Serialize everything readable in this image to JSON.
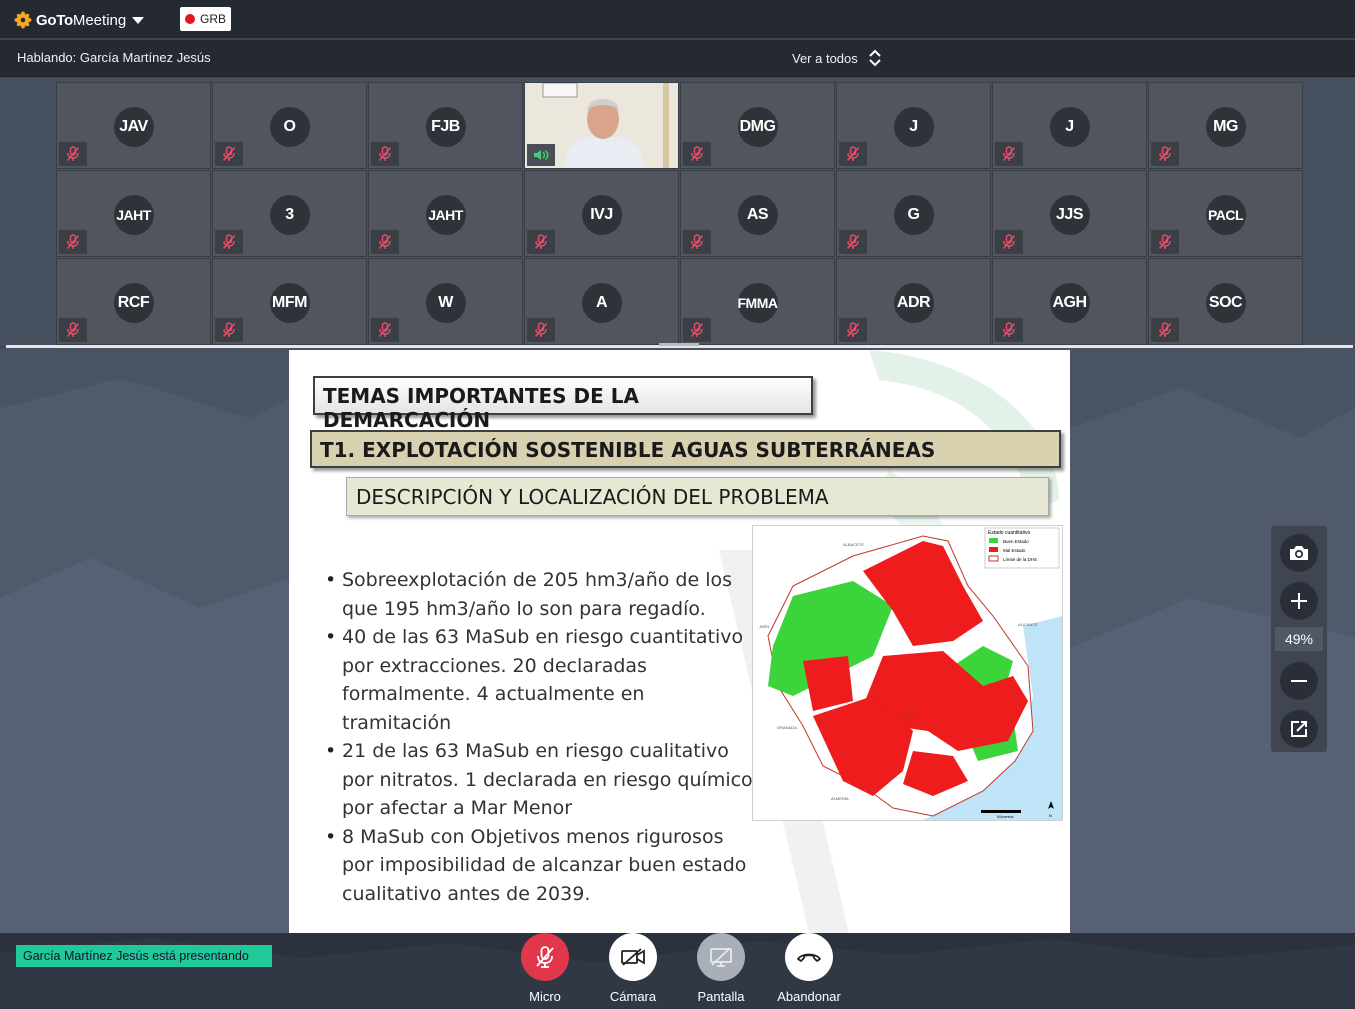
{
  "app": {
    "logo_goto": "GoTo",
    "logo_meeting": "Meeting",
    "recording_label": "GRB"
  },
  "speaker_bar": {
    "speaking_label": "Hablando: García Martínez Jesús",
    "view_label": "Ver a todos"
  },
  "participants": [
    {
      "initials": "JAV",
      "muted": true
    },
    {
      "initials": "O",
      "muted": true
    },
    {
      "initials": "FJB",
      "muted": true
    },
    {
      "initials": "",
      "video": true,
      "speaking": true
    },
    {
      "initials": "DMG",
      "muted": true
    },
    {
      "initials": "J",
      "muted": true
    },
    {
      "initials": "J",
      "muted": true
    },
    {
      "initials": "MG",
      "muted": true
    },
    {
      "initials": "JAHT",
      "muted": true
    },
    {
      "initials": "3",
      "muted": true
    },
    {
      "initials": "JAHT",
      "muted": true
    },
    {
      "initials": "IVJ",
      "muted": true
    },
    {
      "initials": "AS",
      "muted": true
    },
    {
      "initials": "G",
      "muted": true
    },
    {
      "initials": "JJS",
      "muted": true
    },
    {
      "initials": "PACL",
      "muted": true
    },
    {
      "initials": "RCF",
      "muted": true
    },
    {
      "initials": "MFM",
      "muted": true
    },
    {
      "initials": "W",
      "muted": true
    },
    {
      "initials": "A",
      "muted": true
    },
    {
      "initials": "FMMA",
      "muted": true
    },
    {
      "initials": "ADR",
      "muted": true
    },
    {
      "initials": "AGH",
      "muted": true
    },
    {
      "initials": "SOC",
      "muted": true
    }
  ],
  "slide": {
    "title": "TEMAS IMPORTANTES DE LA DEMARCACIÓN",
    "subtitle": "T1. EXPLOTACIÓN SOSTENIBLE AGUAS SUBTERRÁNEAS",
    "section": "DESCRIPCIÓN Y LOCALIZACIÓN DEL PROBLEMA",
    "bullets": [
      "Sobreexplotación de 205 hm3/año de los que 195 hm3/año lo son para regadío.",
      "40 de las 63 MaSub en riesgo cuantitativo por extracciones. 20 declaradas formalmente. 4 actualmente en tramitación",
      "21 de las 63 MaSub en riesgo cualitativo por nitratos. 1 declarada en riesgo químico por  afectar a Mar Menor",
      "8 MaSub con Objetivos menos rigurosos por imposibilidad de alcanzar buen estado cualitativo antes de 2039."
    ],
    "map": {
      "legend_title": "Estado cuantitativo",
      "legend_items": [
        {
          "label": "Buen Estado",
          "color": "#3bd43b"
        },
        {
          "label": "Mal Estado",
          "color": "#ee1c1c"
        },
        {
          "label": "Límite de la DHS",
          "color": "#c0392b"
        }
      ],
      "place_labels": [
        "ALBACETE",
        "JAÉN",
        "ALICANTE",
        "GRANADA",
        "MURCIA",
        "ALMERÍA"
      ],
      "scale_label": "Kilómetros",
      "north_label": "N"
    }
  },
  "zoom": {
    "level": "49%"
  },
  "bottom": {
    "presenting_label": "García Martínez Jesús está presentando",
    "controls": {
      "mic": "Micro",
      "camera": "Cámara",
      "screen": "Pantalla",
      "leave": "Abandonar"
    }
  },
  "colors": {
    "mic_active_red": "#e2374a",
    "presenting_green": "#20c997",
    "slide_subtitle_bg": "#d8d1b0",
    "map_good": "#3bd43b",
    "map_bad": "#ee1c1c",
    "map_sea": "#bfe4f7"
  }
}
